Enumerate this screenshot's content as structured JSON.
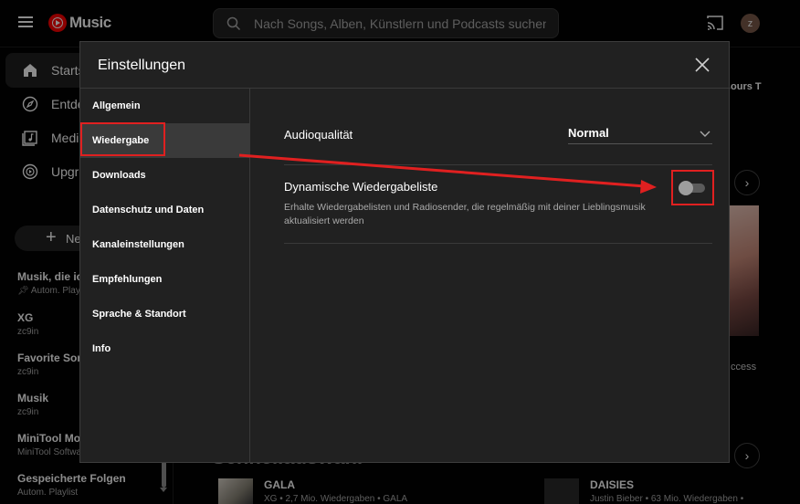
{
  "app": {
    "logo_text": "Music"
  },
  "search": {
    "placeholder": "Nach Songs, Alben, Künstlern und Podcasts suchen"
  },
  "user": {
    "avatar_letter": "z"
  },
  "nav": [
    {
      "label": "Startseite",
      "icon": "home-icon"
    },
    {
      "label": "Entdecken",
      "icon": "compass-icon"
    },
    {
      "label": "Mediathek",
      "icon": "library-icon"
    },
    {
      "label": "Upgrade",
      "icon": "upgrade-icon"
    }
  ],
  "new_playlist": {
    "label": "Neue Playlist"
  },
  "playlists": [
    {
      "title": "Musik, die ich mag",
      "subtitle": "Autom. Playlist"
    },
    {
      "title": "XG",
      "subtitle": "zc9in"
    },
    {
      "title": "Favorite Songs",
      "subtitle": "zc9in"
    },
    {
      "title": "Musik",
      "subtitle": "zc9in"
    },
    {
      "title": "MiniTool MovieMaker",
      "subtitle": "MiniTool Software"
    },
    {
      "title": "Gespeicherte Folgen",
      "subtitle": "Autom. Playlist"
    }
  ],
  "background": {
    "top_right_text": "ours T",
    "right_mid_text": "ccess",
    "section_heading": "Schnellauswahl",
    "songs": [
      {
        "title": "GALA",
        "subtitle": "XG • 2,7 Mio. Wiedergaben • GALA"
      },
      {
        "title": "DAISIES",
        "subtitle": "Justin Bieber • 63 Mio. Wiedergaben •"
      }
    ],
    "arrow_glyph": "›"
  },
  "dialog": {
    "title": "Einstellungen",
    "sidebar": [
      {
        "label": "Allgemein"
      },
      {
        "label": "Wiedergabe"
      },
      {
        "label": "Downloads"
      },
      {
        "label": "Datenschutz und Daten"
      },
      {
        "label": "Kanaleinstellungen"
      },
      {
        "label": "Empfehlungen"
      },
      {
        "label": "Sprache & Standort"
      },
      {
        "label": "Info"
      }
    ],
    "active_item": "Wiedergabe",
    "audio_quality": {
      "label": "Audioqualität",
      "value": "Normal"
    },
    "dynamic_queue": {
      "title": "Dynamische Wiedergabeliste",
      "description": "Erhalte Wiedergabelisten und Radiosender, die regelmäßig mit deiner Lieblingsmusik aktualisiert werden",
      "enabled": false
    }
  },
  "annotation": {
    "color": "#e02020"
  },
  "colors": {
    "brand": "#ff0000",
    "dialog_bg": "#212121",
    "page_bg": "#030303"
  }
}
